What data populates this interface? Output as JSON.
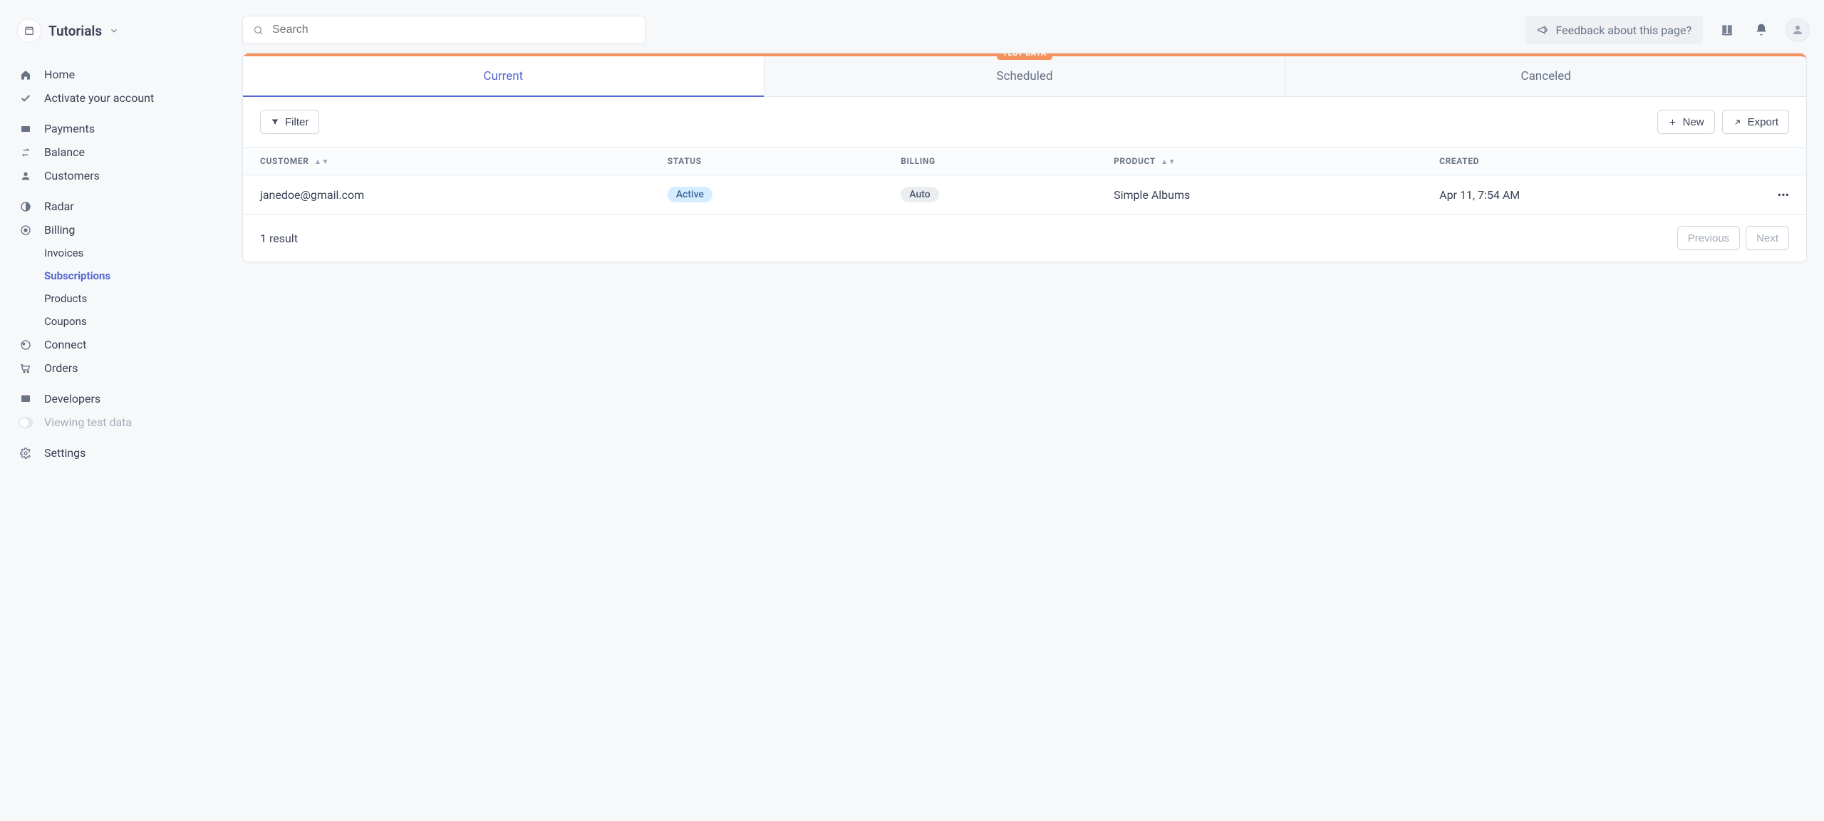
{
  "brand": {
    "name": "Tutorials"
  },
  "search": {
    "placeholder": "Search"
  },
  "feedback": {
    "label": "Feedback about this page?"
  },
  "sidebar": {
    "home": "Home",
    "activate": "Activate your account",
    "payments": "Payments",
    "balance": "Balance",
    "customers": "Customers",
    "radar": "Radar",
    "billing": "Billing",
    "billing_children": {
      "invoices": "Invoices",
      "subscriptions": "Subscriptions",
      "products": "Products",
      "coupons": "Coupons"
    },
    "connect": "Connect",
    "orders": "Orders",
    "developers": "Developers",
    "viewing_test": "Viewing test data",
    "settings": "Settings"
  },
  "tabs": {
    "current": "Current",
    "scheduled": "Scheduled",
    "canceled": "Canceled",
    "badge": "TEST DATA"
  },
  "toolbar": {
    "filter": "Filter",
    "new": "New",
    "export": "Export"
  },
  "table": {
    "headers": {
      "customer": "CUSTOMER",
      "status": "STATUS",
      "billing": "BILLING",
      "product": "PRODUCT",
      "created": "CREATED"
    },
    "rows": [
      {
        "customer": "janedoe@gmail.com",
        "status": "Active",
        "billing": "Auto",
        "product": "Simple Albums",
        "created": "Apr 11, 7:54 AM"
      }
    ]
  },
  "footer": {
    "result_text": "1 result",
    "prev": "Previous",
    "next": "Next"
  }
}
